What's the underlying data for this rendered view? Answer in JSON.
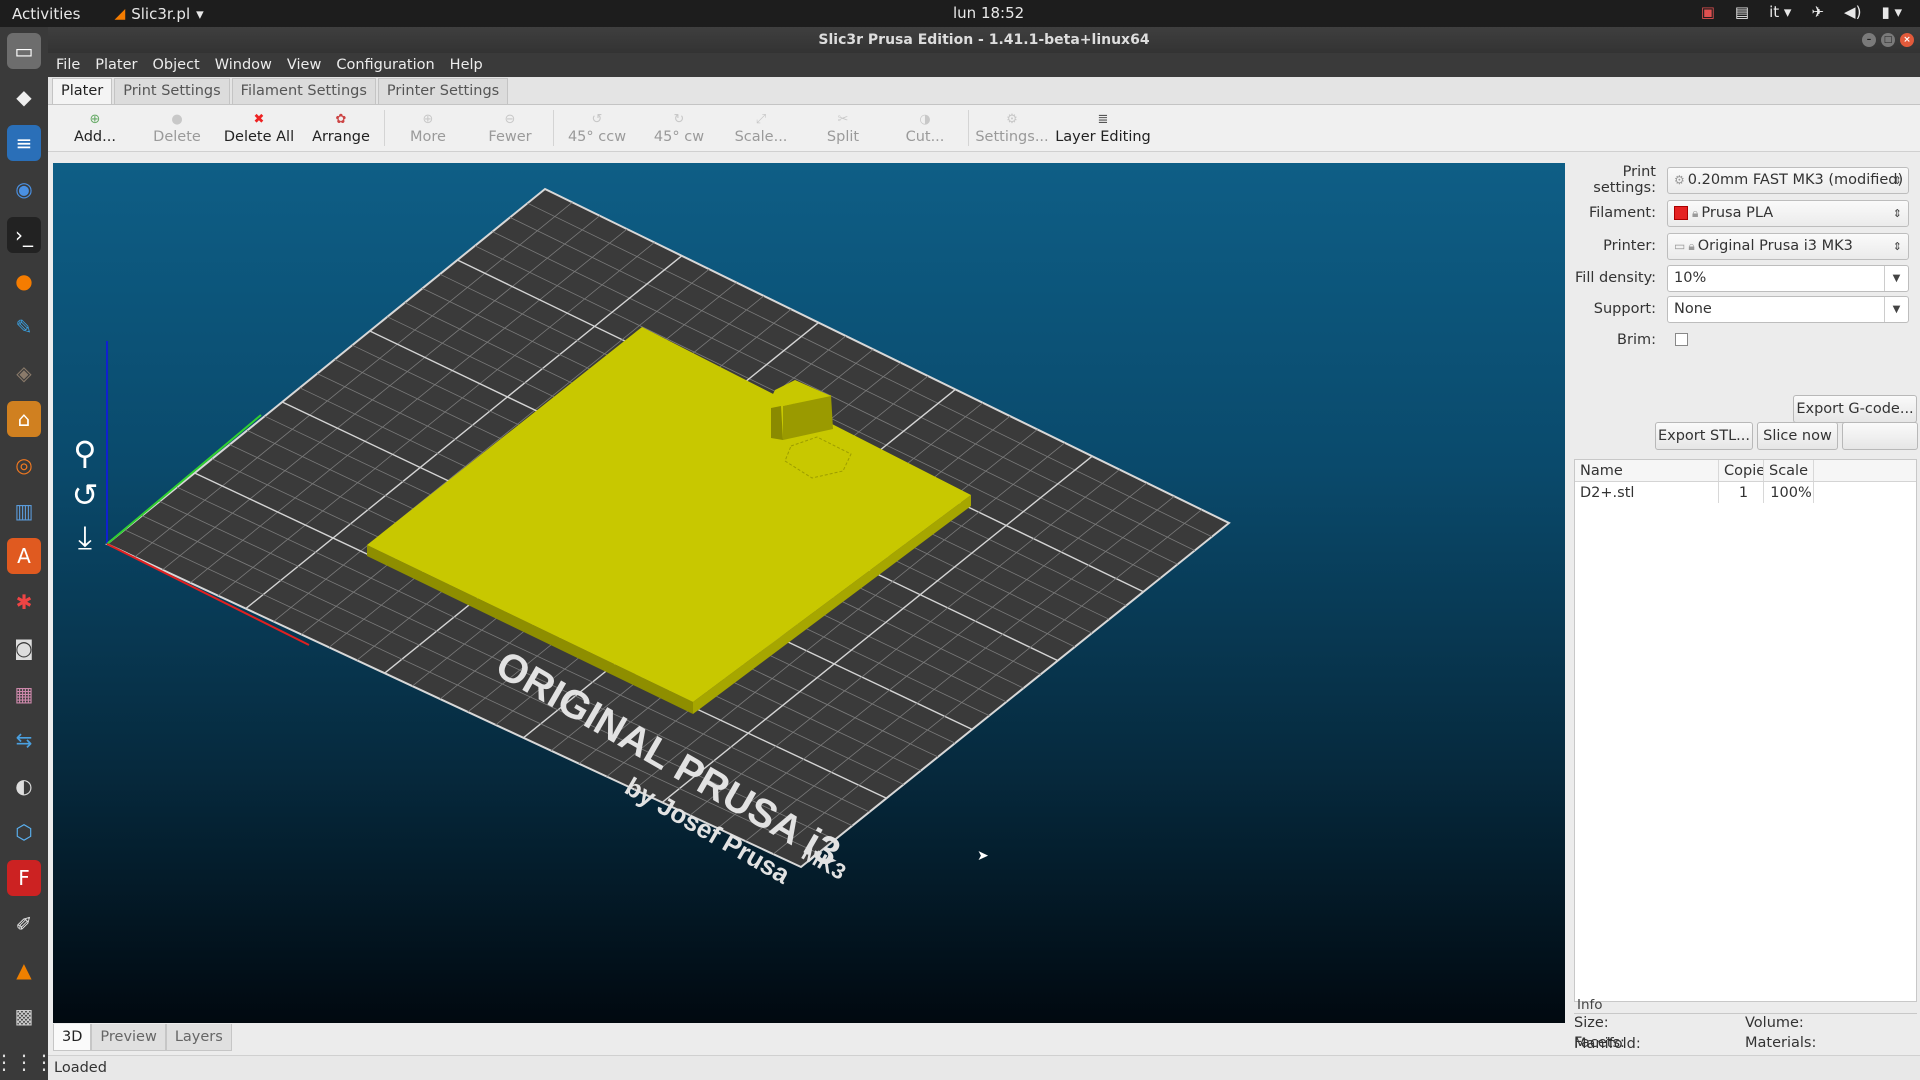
{
  "topbar": {
    "activities": "Activities",
    "app_name": "Slic3r.pl",
    "clock": "lun 18:52",
    "input_lang": "it"
  },
  "window": {
    "title": "Slic3r Prusa Edition - 1.41.1-beta+linux64"
  },
  "menu": [
    "File",
    "Plater",
    "Object",
    "Window",
    "View",
    "Configuration",
    "Help"
  ],
  "tabs": [
    "Plater",
    "Print Settings",
    "Filament Settings",
    "Printer Settings"
  ],
  "toolbar": {
    "add": "Add...",
    "delete": "Delete",
    "delete_all": "Delete All",
    "arrange": "Arrange",
    "more": "More",
    "fewer": "Fewer",
    "rotate_ccw": "45° ccw",
    "rotate_cw": "45° cw",
    "scale": "Scale...",
    "split": "Split",
    "cut": "Cut...",
    "settings": "Settings...",
    "layer_editing": "Layer Editing"
  },
  "settings": {
    "print_label": "Print settings:",
    "print_value": "0.20mm FAST MK3 (modified)",
    "filament_label": "Filament:",
    "filament_value": "Prusa PLA",
    "filament_color": "#e52222",
    "printer_label": "Printer:",
    "printer_value": "Original Prusa i3 MK3",
    "fill_density_label": "Fill density:",
    "fill_density_value": "10%",
    "support_label": "Support:",
    "support_value": "None",
    "brim_label": "Brim:",
    "brim_checked": false
  },
  "actions": {
    "export_stl": "Export STL...",
    "slice_now": "Slice now",
    "export_gcode": "Export G-code..."
  },
  "object_list": {
    "headers": [
      "Name",
      "Copie",
      "Scale"
    ],
    "rows": [
      {
        "name": "D2+.stl",
        "copies": "1",
        "scale": "100%"
      }
    ]
  },
  "info": {
    "title": "Info",
    "size_label": "Size:",
    "volume_label": "Volume:",
    "facets_label": "Facets:",
    "materials_label": "Materials:",
    "manifold_label": "Manifold:"
  },
  "bed": {
    "brand_line1": "ORIGINAL PRUSA i3",
    "brand_mk": "MK3",
    "brand_line2": "by Josef Prusa",
    "model_color": "#c8c800"
  },
  "view_tabs": [
    "3D",
    "Preview",
    "Layers"
  ],
  "status": "Loaded"
}
